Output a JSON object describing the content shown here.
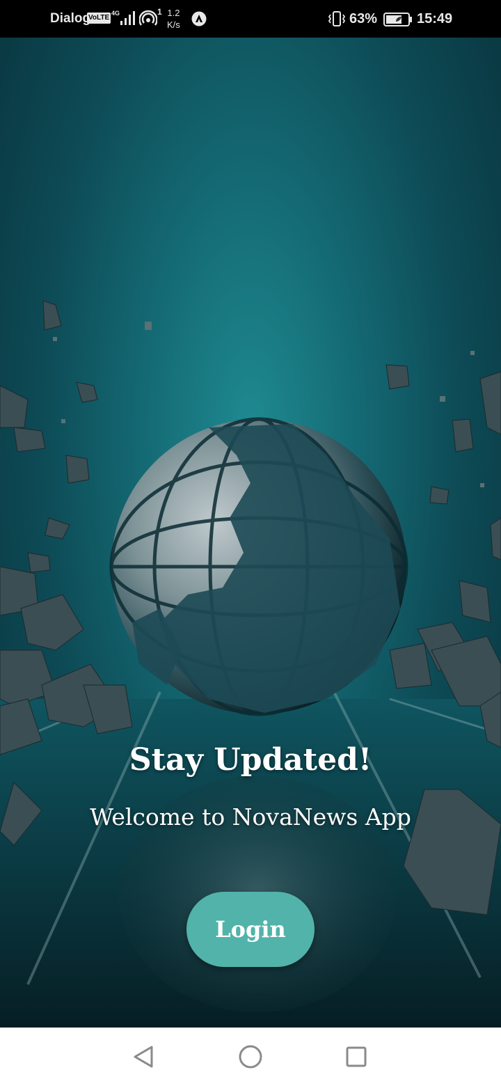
{
  "status_bar": {
    "carrier": "Dialog",
    "volte": "VoLTE",
    "network": "4G",
    "hotspot_count": "1",
    "speed_value": "1.2",
    "speed_unit": "K/s",
    "battery_percent": "63%",
    "time": "15:49"
  },
  "welcome": {
    "headline": "Stay Updated!",
    "subtitle": "Welcome to NovaNews App",
    "login_label": "Login"
  },
  "nav_bar": {
    "icons": [
      "back-icon",
      "home-icon",
      "recents-icon"
    ]
  },
  "colors": {
    "accent": "#52b3aa",
    "background_teal": "#146a74",
    "text": "#ffffff"
  }
}
